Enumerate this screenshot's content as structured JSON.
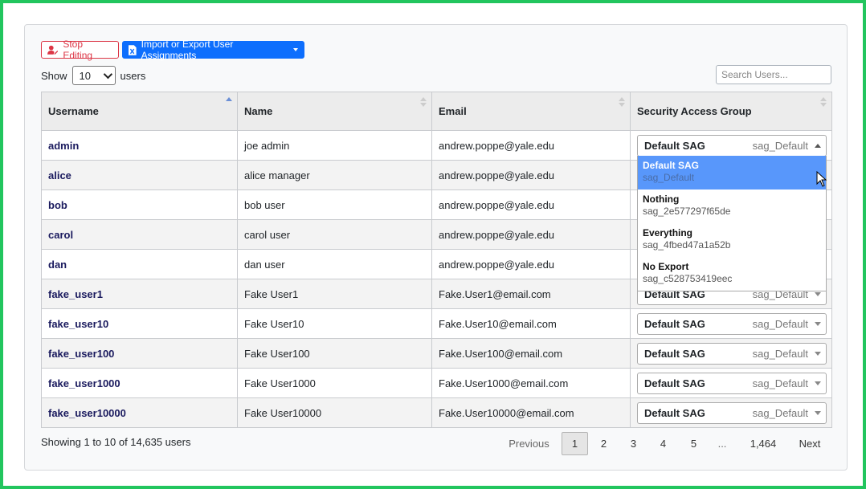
{
  "toolbar": {
    "stop_editing": "Stop Editing",
    "import_export": "Import or Export User Assignments"
  },
  "length": {
    "show": "Show",
    "value": "10",
    "suffix": "users"
  },
  "search": {
    "placeholder": "Search Users..."
  },
  "columns": [
    "Username",
    "Name",
    "Email",
    "Security Access Group"
  ],
  "rows": [
    {
      "username": "admin",
      "name": "joe admin",
      "email": "andrew.poppe@yale.edu",
      "sag": "Default SAG",
      "sag_code": "sag_Default"
    },
    {
      "username": "alice",
      "name": "alice manager",
      "email": "andrew.poppe@yale.edu",
      "sag": "",
      "sag_code": ""
    },
    {
      "username": "bob",
      "name": "bob user",
      "email": "andrew.poppe@yale.edu",
      "sag": "",
      "sag_code": ""
    },
    {
      "username": "carol",
      "name": "carol user",
      "email": "andrew.poppe@yale.edu",
      "sag": "",
      "sag_code": ""
    },
    {
      "username": "dan",
      "name": "dan user",
      "email": "andrew.poppe@yale.edu",
      "sag": "",
      "sag_code": ""
    },
    {
      "username": "fake_user1",
      "name": "Fake User1",
      "email": "Fake.User1@email.com",
      "sag": "Default SAG",
      "sag_code": "sag_Default"
    },
    {
      "username": "fake_user10",
      "name": "Fake User10",
      "email": "Fake.User10@email.com",
      "sag": "Default SAG",
      "sag_code": "sag_Default"
    },
    {
      "username": "fake_user100",
      "name": "Fake User100",
      "email": "Fake.User100@email.com",
      "sag": "Default SAG",
      "sag_code": "sag_Default"
    },
    {
      "username": "fake_user1000",
      "name": "Fake User1000",
      "email": "Fake.User1000@email.com",
      "sag": "Default SAG",
      "sag_code": "sag_Default"
    },
    {
      "username": "fake_user10000",
      "name": "Fake User10000",
      "email": "Fake.User10000@email.com",
      "sag": "Default SAG",
      "sag_code": "sag_Default"
    }
  ],
  "dropdown_options": [
    {
      "title": "Default SAG",
      "code": "sag_Default",
      "selected": true
    },
    {
      "title": "Nothing",
      "code": "sag_2e577297f65de",
      "selected": false
    },
    {
      "title": "Everything",
      "code": "sag_4fbed47a1a52b",
      "selected": false
    },
    {
      "title": "No Export",
      "code": "sag_c528753419eec",
      "selected": false
    }
  ],
  "info": "Showing 1 to 10 of 14,635 users",
  "pagination": {
    "previous": "Previous",
    "pages": [
      "1",
      "2",
      "3",
      "4",
      "5",
      "...",
      "1,464"
    ],
    "current": "1",
    "next": "Next"
  },
  "colors": {
    "frame": "#22c55e",
    "primary": "#0d6efd",
    "danger": "#dc3545",
    "highlight": "#5897fb"
  }
}
